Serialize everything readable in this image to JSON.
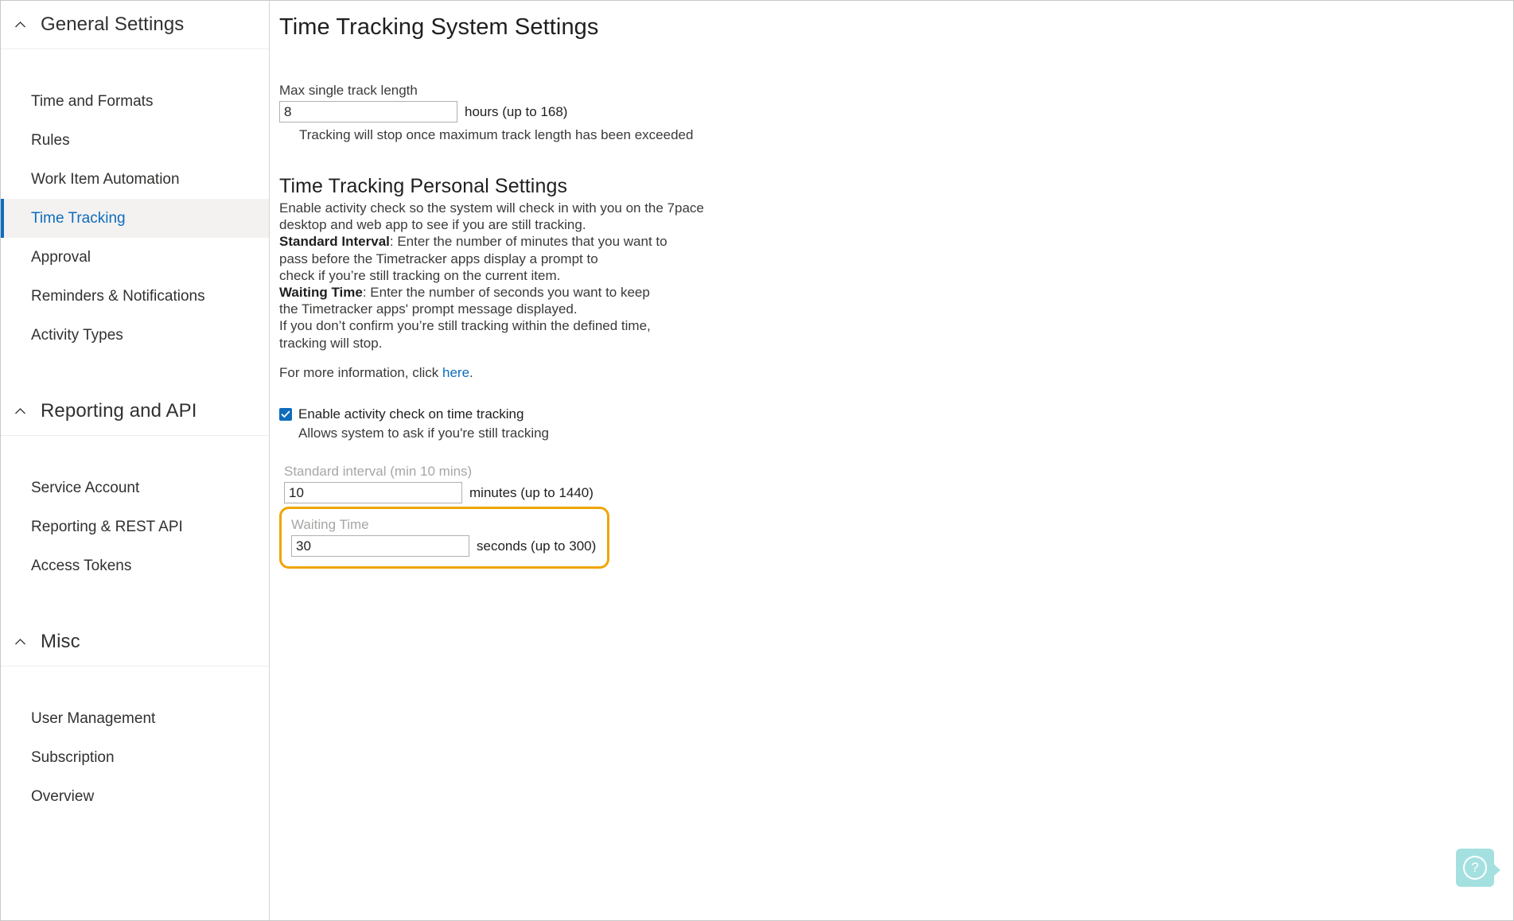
{
  "sidebar": {
    "groups": [
      {
        "id": "general-settings",
        "title": "General Settings",
        "caret": "chevron-up-icon",
        "items": [
          {
            "label": "Time and Formats",
            "active": false
          },
          {
            "label": "Rules",
            "active": false
          },
          {
            "label": "Work Item Automation",
            "active": false
          },
          {
            "label": "Time Tracking",
            "active": true
          },
          {
            "label": "Approval",
            "active": false
          },
          {
            "label": "Reminders & Notifications",
            "active": false
          },
          {
            "label": "Activity Types",
            "active": false
          }
        ]
      },
      {
        "id": "reporting-and-api",
        "title": "Reporting and API",
        "caret": "chevron-up-icon",
        "items": [
          {
            "label": "Service Account",
            "active": false
          },
          {
            "label": "Reporting & REST API",
            "active": false
          },
          {
            "label": "Access Tokens",
            "active": false
          }
        ]
      },
      {
        "id": "misc",
        "title": "Misc",
        "caret": "chevron-up-icon",
        "items": [
          {
            "label": "User Management",
            "active": false
          },
          {
            "label": "Subscription",
            "active": false
          },
          {
            "label": "Overview",
            "active": false
          }
        ]
      }
    ]
  },
  "main": {
    "page_title": "Time Tracking System Settings",
    "max_track": {
      "label": "Max single track length",
      "value": "8",
      "placeholder": "",
      "unit": "hours (up to 168)",
      "hint": "Tracking will stop once maximum track length has been exceeded"
    },
    "personal": {
      "heading": "Time Tracking Personal Settings",
      "lines": [
        "Enable activity check so the system will check in with you on the 7pace",
        "desktop and web app to see if you are still tracking."
      ],
      "standard_interval_label": "Standard Interval",
      "standard_interval_lines": [
        ": Enter the number of minutes that you want to",
        "pass before the Timetracker apps display a prompt to",
        "check if you’re still tracking on the current item."
      ],
      "waiting_time_label": "Waiting Time",
      "waiting_time_lines": [
        ": Enter the number of seconds you want to keep",
        "the Timetracker apps' prompt message displayed.",
        "If you don’t confirm you’re still tracking within the defined time,",
        "tracking will stop."
      ],
      "more_info_prefix": "For more information, click ",
      "more_info_link": "here",
      "more_info_suffix": "."
    },
    "activity_check": {
      "checked": true,
      "label": "Enable activity check on time tracking",
      "sub_label": "Allows system to ask if you're still tracking"
    },
    "standard_interval_field": {
      "label": "Standard interval (min 10 mins)",
      "value": "10",
      "placeholder": "",
      "unit": "minutes (up to 1440)"
    },
    "waiting_time_field": {
      "label": "Waiting Time",
      "value": "30",
      "placeholder": "",
      "unit": "seconds (up to 300)",
      "highlighted": true,
      "highlight_color": "#f0a500"
    }
  },
  "help": {
    "icon": "question-mark-icon",
    "color": "#a5e0e0"
  },
  "colors": {
    "accent": "#0f6cbd",
    "highlight": "#f0a500",
    "selected_bg": "#f3f2f1",
    "text": "#201f1e",
    "muted_text": "#a8a6a4"
  }
}
